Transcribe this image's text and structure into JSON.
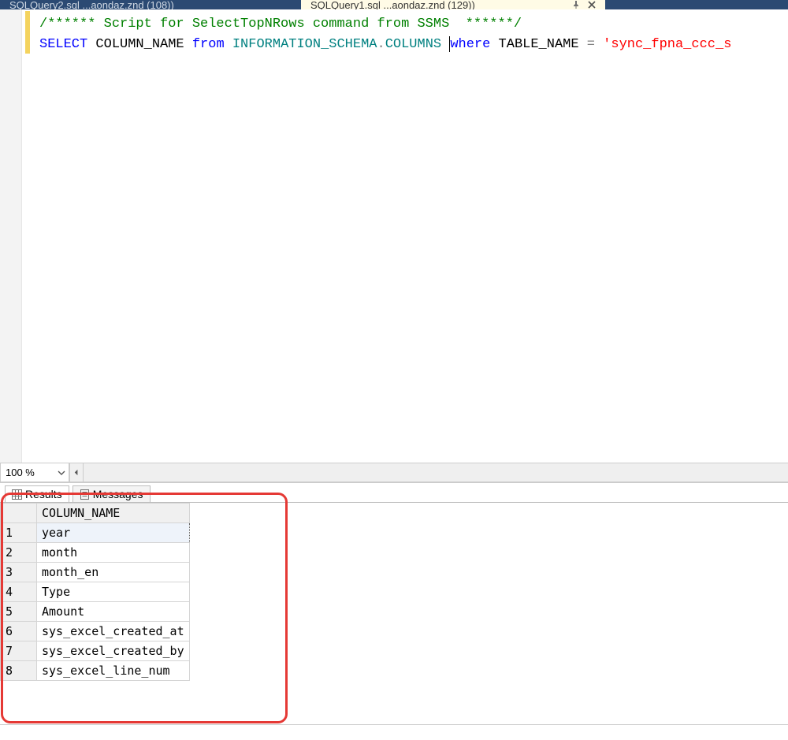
{
  "tabs": {
    "inactive": {
      "label": "SQLQuery2.sql ...aondaz.znd (108))"
    },
    "active": {
      "label": "SQLQuery1.sql ...aondaz.znd (129))"
    }
  },
  "editor": {
    "comment": "/****** Script for SelectTopNRows command from SSMS  ******/",
    "kw_select": "SELECT",
    "col": " COLUMN_NAME ",
    "kw_from": "from",
    "schema": " INFORMATION_SCHEMA",
    "dot": ".",
    "schema2": "COLUMNS ",
    "kw_where": "where",
    "col2": " TABLE_NAME ",
    "eq": "=",
    "strlit": " 'sync_fpna_ccc_s"
  },
  "zoom": {
    "value": "100 %"
  },
  "results": {
    "tabs": {
      "results": "Results",
      "messages": "Messages"
    },
    "header": "COLUMN_NAME",
    "rows": [
      {
        "n": "1",
        "v": "year"
      },
      {
        "n": "2",
        "v": "month"
      },
      {
        "n": "3",
        "v": "month_en"
      },
      {
        "n": "4",
        "v": "Type"
      },
      {
        "n": "5",
        "v": "Amount"
      },
      {
        "n": "6",
        "v": "sys_excel_created_at"
      },
      {
        "n": "7",
        "v": "sys_excel_created_by"
      },
      {
        "n": "8",
        "v": "sys_excel_line_num"
      }
    ]
  }
}
